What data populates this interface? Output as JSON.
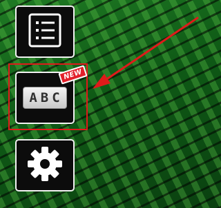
{
  "toolbar": {
    "buttons": [
      {
        "id": "menu",
        "icon": "list-icon"
      },
      {
        "id": "text",
        "icon": "abc-text-icon",
        "label": "ABC",
        "badge": "NEW"
      },
      {
        "id": "settings",
        "icon": "gear-icon"
      }
    ]
  },
  "annotation": {
    "color": "#e01a1a"
  },
  "colors": {
    "button_bg": "#0c0c0c",
    "button_border": "#f2f2f2",
    "badge_bg": "#e2202a",
    "background_green": "#1f7a24"
  }
}
